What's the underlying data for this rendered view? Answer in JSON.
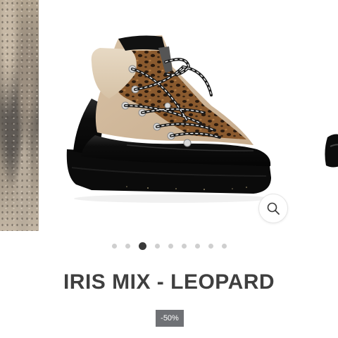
{
  "product": {
    "title": "IRIS MIX - LEOPARD",
    "discount_badge": "-50%"
  },
  "gallery": {
    "slide_count": 9,
    "active_index": 2,
    "zoom_icon": "search-icon",
    "colors": {
      "dot_inactive": "#cfcfcf",
      "dot_active": "#3a3a3a",
      "badge_bg": "#6f7175",
      "title_text": "#3f3f3f"
    }
  }
}
